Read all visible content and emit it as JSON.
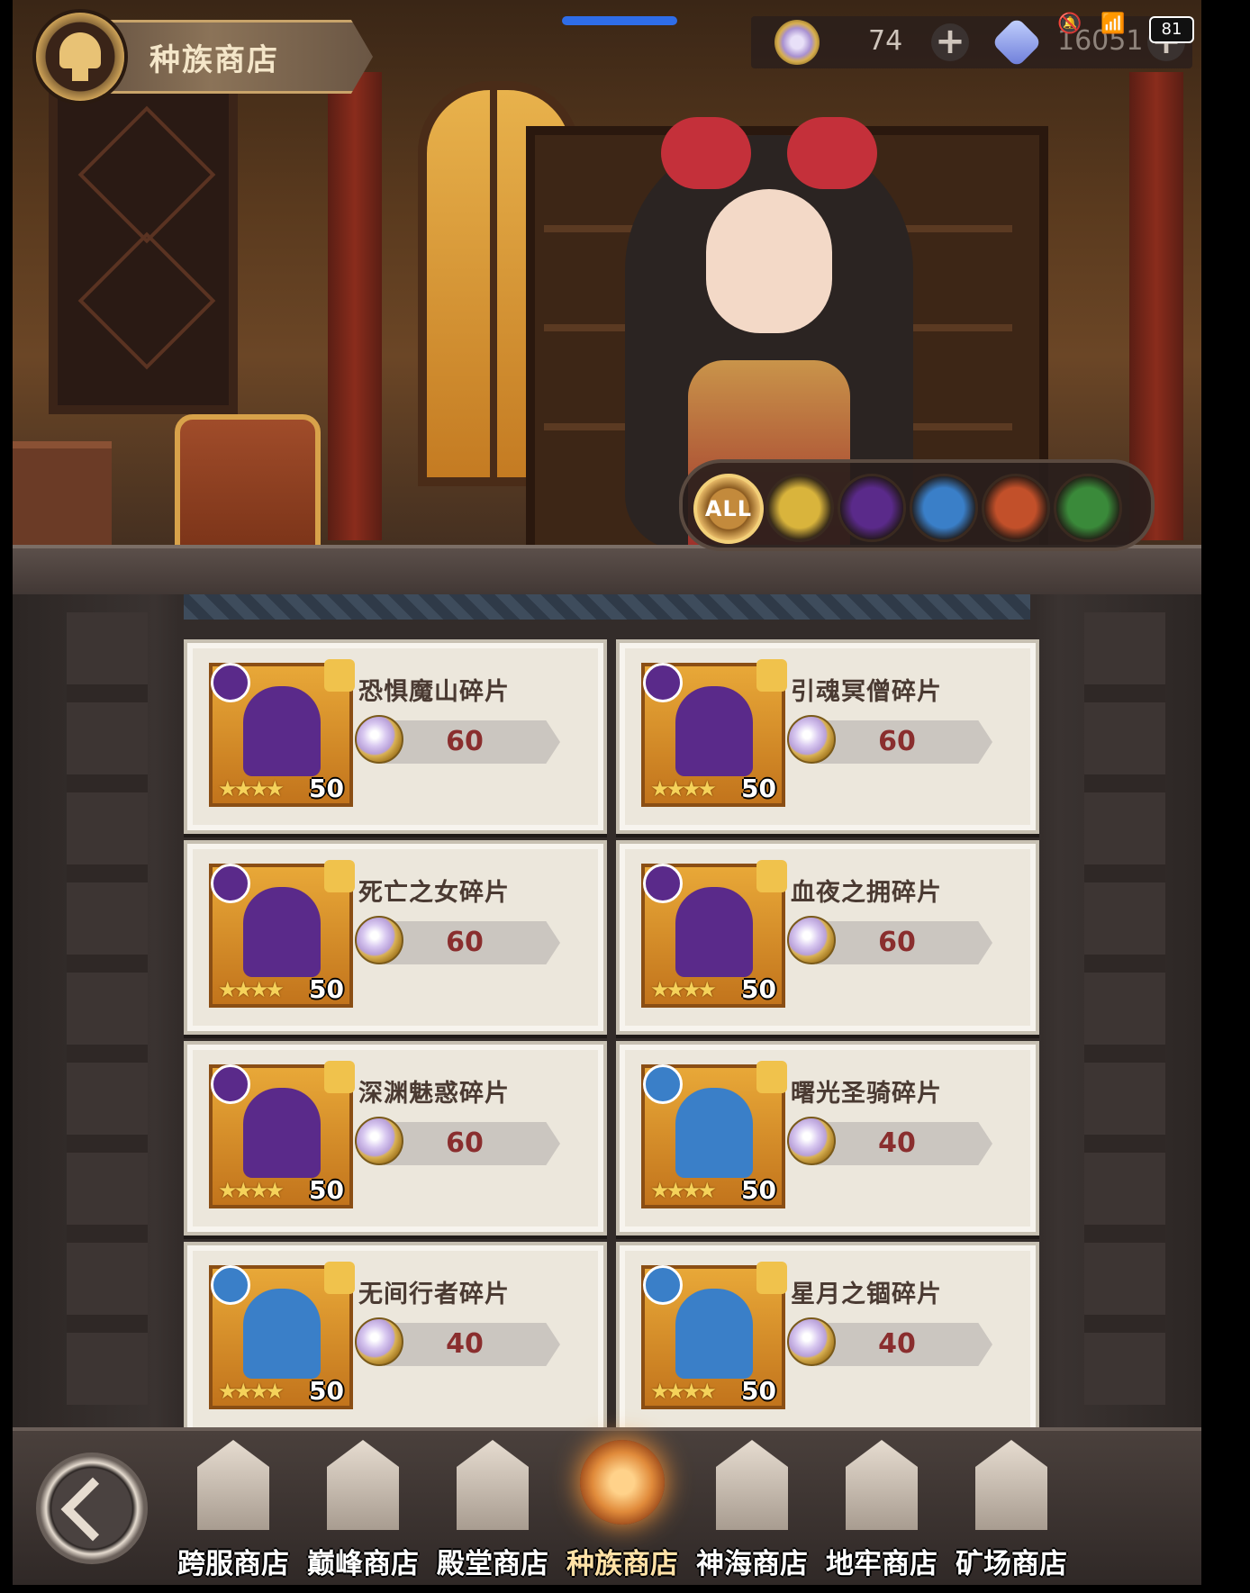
{
  "header": {
    "title": "种族商店",
    "resource_1_value": "74",
    "resource_2_value": "16051",
    "battery": "81"
  },
  "filters": {
    "all_label": "ALL",
    "items": [
      {
        "name": "light-faction-icon",
        "color": "#d9b43c"
      },
      {
        "name": "dark-faction-icon",
        "color": "#5a2a8a"
      },
      {
        "name": "graveborn-faction-icon",
        "color": "#3a7fc8"
      },
      {
        "name": "beast-faction-icon",
        "color": "#c2502a"
      },
      {
        "name": "nature-faction-icon",
        "color": "#3a8a3a"
      }
    ]
  },
  "items": [
    {
      "name": "恐惧魔山碎片",
      "price": "60",
      "stars": "★★★★",
      "level": "50",
      "faction_color": "#5a2a8a",
      "char_color": "#2b3550"
    },
    {
      "name": "引魂冥僧碎片",
      "price": "60",
      "stars": "★★★★",
      "level": "50",
      "faction_color": "#5a2a8a",
      "char_color": "#b8342e"
    },
    {
      "name": "死亡之女碎片",
      "price": "60",
      "stars": "★★★★",
      "level": "50",
      "faction_color": "#5a2a8a",
      "char_color": "#1e1a1a"
    },
    {
      "name": "血夜之拥碎片",
      "price": "60",
      "stars": "★★★★",
      "level": "50",
      "faction_color": "#5a2a8a",
      "char_color": "#e8e4e0"
    },
    {
      "name": "深渊魅惑碎片",
      "price": "60",
      "stars": "★★★★",
      "level": "50",
      "faction_color": "#5a2a8a",
      "char_color": "#c8d2e0"
    },
    {
      "name": "曙光圣骑碎片",
      "price": "40",
      "stars": "★★★★",
      "level": "50",
      "faction_color": "#3a7fc8",
      "char_color": "#f0e4a8"
    },
    {
      "name": "无间行者碎片",
      "price": "40",
      "stars": "★★★★",
      "level": "50",
      "faction_color": "#3a7fc8",
      "char_color": "#6a4a3a"
    },
    {
      "name": "星月之锢碎片",
      "price": "40",
      "stars": "★★★★",
      "level": "50",
      "faction_color": "#3a7fc8",
      "char_color": "#e8d8a0"
    }
  ],
  "bottom_nav": [
    {
      "label": "跨服商店"
    },
    {
      "label": "巅峰商店"
    },
    {
      "label": "殿堂商店"
    },
    {
      "label": "种族商店",
      "active": true
    },
    {
      "label": "神海商店"
    },
    {
      "label": "地牢商店"
    },
    {
      "label": "矿场商店"
    }
  ]
}
